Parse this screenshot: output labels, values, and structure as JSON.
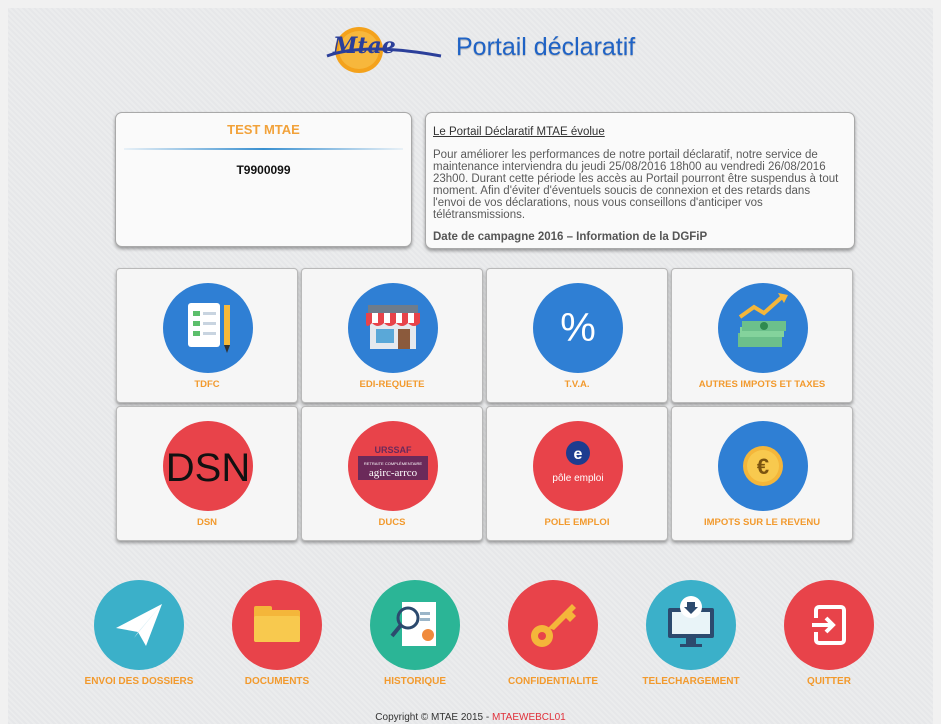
{
  "header": {
    "logo_text": "Mtae",
    "title": "Portail déclaratif"
  },
  "company": {
    "name": "TEST MTAE",
    "code": "T9900099"
  },
  "news": {
    "title": "Le Portail Déclaratif MTAE évolue",
    "body": "Pour améliorer les performances de notre portail déclaratif, notre service de maintenance interviendra du jeudi 25/08/2016 18h00 au vendredi 26/08/2016 23h00. Durant cette période les accès au Portail pourront être suspendus à tout moment. Afin d'éviter d'éventuels soucis de connexion et des retards dans l'envoi de vos déclarations, nous vous conseillons d'anticiper vos télétransmissions.",
    "subtitle": "Date de campagne 2016 – Information de la DGFiP"
  },
  "tiles": [
    {
      "label": "TDFC",
      "icon": "document-checklist-icon"
    },
    {
      "label": "EDI-REQUETE",
      "icon": "storefront-icon"
    },
    {
      "label": "T.V.A.",
      "icon": "percent-icon"
    },
    {
      "label": "AUTRES IMPOTS ET TAXES",
      "icon": "money-growth-icon"
    },
    {
      "label": "DSN",
      "icon": "dsn-logo-icon",
      "logo_text": "DSN"
    },
    {
      "label": "DUCS",
      "icon": "urssaf-logo-icon",
      "logo_text_top": "URSSAF",
      "logo_text_mid": "RETRAITE COMPLÉMENTAIRE",
      "logo_text_bottom": "agirc-arrco"
    },
    {
      "label": "POLE EMPLOI",
      "icon": "pole-emploi-logo-icon",
      "logo_text": "pôle emploi"
    },
    {
      "label": "IMPOTS SUR LE REVENU",
      "icon": "euro-coin-icon"
    }
  ],
  "bottom_actions": [
    {
      "label": "ENVOI DES DOSSIERS",
      "icon": "paper-plane-icon"
    },
    {
      "label": "DOCUMENTS",
      "icon": "folder-icon"
    },
    {
      "label": "HISTORIQUE",
      "icon": "report-search-icon"
    },
    {
      "label": "CONFIDENTIALITE",
      "icon": "key-icon"
    },
    {
      "label": "TELECHARGEMENT",
      "icon": "download-monitor-icon"
    },
    {
      "label": "QUITTER",
      "icon": "exit-icon"
    }
  ],
  "footer": {
    "copyright": "Copyright © MTAE 2015 - ",
    "code": "MTAEWEBCL01"
  },
  "colors": {
    "accent_orange": "#f29a2e",
    "title_blue": "#1f63c6",
    "circle_blue": "#2f7fd4",
    "circle_red": "#e8434a",
    "circle_teal": "#3bb0c9",
    "circle_green": "#2bb596"
  }
}
